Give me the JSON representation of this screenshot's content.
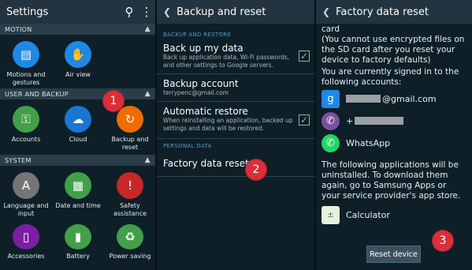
{
  "panel1": {
    "title": "Settings",
    "sections": [
      {
        "label": "MOTION",
        "items": [
          {
            "label": "Motions and gestures",
            "icon": "motion-icon",
            "color": "#1e88e5"
          },
          {
            "label": "Air view",
            "icon": "air-view-icon",
            "color": "#1e88e5"
          }
        ]
      },
      {
        "label": "USER AND BACKUP",
        "items": [
          {
            "label": "Accounts",
            "icon": "key-icon",
            "color": "#43a047"
          },
          {
            "label": "Cloud",
            "icon": "cloud-icon",
            "color": "#1976d2"
          },
          {
            "label": "Backup and reset",
            "icon": "backup-icon",
            "color": "#ef6c00"
          }
        ]
      },
      {
        "label": "SYSTEM",
        "items": [
          {
            "label": "Language and input",
            "icon": "language-icon",
            "color": "#757575"
          },
          {
            "label": "Date and time",
            "icon": "calendar-icon",
            "color": "#43a047"
          },
          {
            "label": "Safety assistance",
            "icon": "safety-icon",
            "color": "#c62828"
          }
        ]
      },
      {
        "label": "",
        "items": [
          {
            "label": "Accessories",
            "icon": "accessories-icon",
            "color": "#7b1fa2"
          },
          {
            "label": "Battery",
            "icon": "battery-icon",
            "color": "#43a047"
          },
          {
            "label": "Power saving",
            "icon": "power-saving-icon",
            "color": "#43a047"
          }
        ]
      }
    ],
    "marker": "1"
  },
  "panel2": {
    "title": "Backup and reset",
    "section1": "BACKUP AND RESTORE",
    "rows": [
      {
        "title": "Back up my data",
        "desc": "Back up application data, Wi-Fi passwords, and other settings to Google servers.",
        "checked": true
      },
      {
        "title": "Backup account",
        "desc": "terrypenc@gmail.com",
        "checked": false
      },
      {
        "title": "Automatic restore",
        "desc": "When reinstalling an application, backed up settings and data will be restored.",
        "checked": true
      }
    ],
    "section2": "PERSONAL DATA",
    "reset_label": "Factory data reset",
    "marker": "2"
  },
  "panel3": {
    "title": "Factory data reset",
    "text1": "card\n(You cannot use encrypted files on the SD card after you reset your device to factory defaults)",
    "text2": "You are currently signed in to the following accounts:",
    "accounts": [
      {
        "icon": "google-icon",
        "name": "@gmail.com",
        "color": "#1e88e5"
      },
      {
        "icon": "viber-icon",
        "name": "+",
        "color": "#7b519d"
      },
      {
        "icon": "whatsapp-icon",
        "name": "WhatsApp",
        "color": "#25d366"
      }
    ],
    "text3": "The following applications will be uninstalled. To download them again, go to Samsung Apps or your service provider's app store.",
    "app": "Calculator",
    "button": "Reset device",
    "marker": "3"
  }
}
